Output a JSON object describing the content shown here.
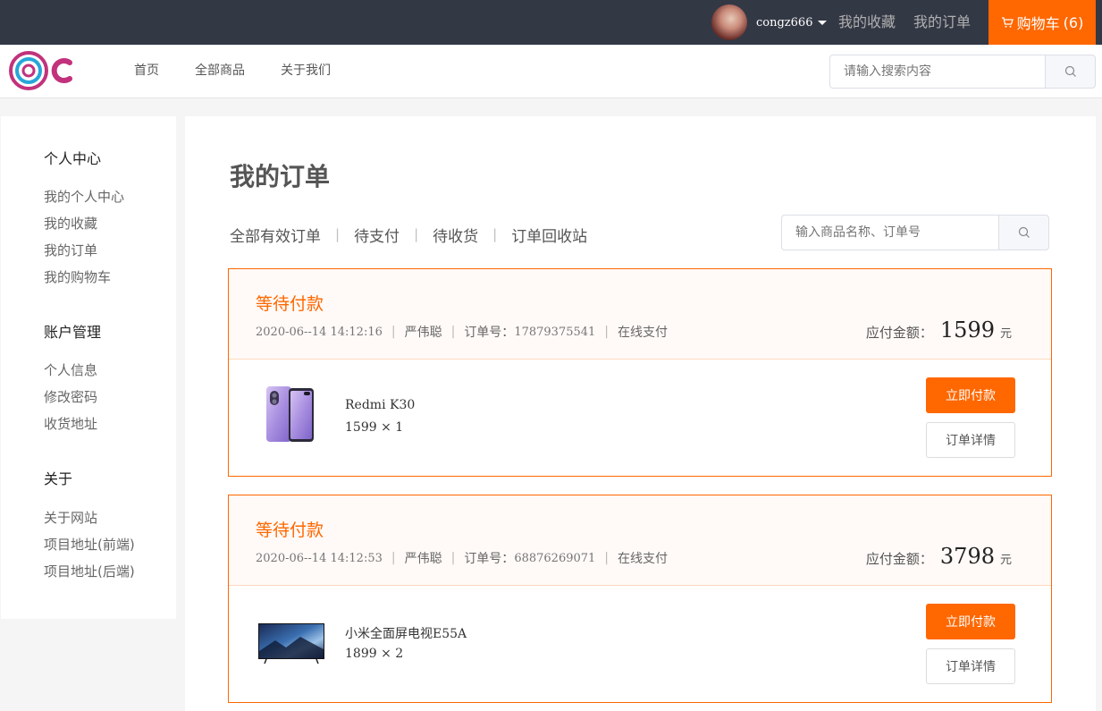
{
  "topbar": {
    "username": "congz666",
    "links": [
      "我的收藏",
      "我的订单"
    ],
    "cart_label": "购物车",
    "cart_count": "(6)"
  },
  "header": {
    "nav": [
      "首页",
      "全部商品",
      "关于我们"
    ],
    "search_placeholder": "请输入搜索内容"
  },
  "sidebar": {
    "groups": [
      {
        "title": "个人中心",
        "items": [
          "我的个人中心",
          "我的收藏",
          "我的订单",
          "我的购物车"
        ]
      },
      {
        "title": "账户管理",
        "items": [
          "个人信息",
          "修改密码",
          "收货地址"
        ]
      },
      {
        "title": "关于",
        "items": [
          "关于网站",
          "项目地址(前端)",
          "项目地址(后端)"
        ]
      }
    ]
  },
  "main": {
    "title": "我的订单",
    "filters": [
      "全部有效订单",
      "待支付",
      "待收货",
      "订单回收站"
    ],
    "search_placeholder": "输入商品名称、订单号"
  },
  "orders": [
    {
      "status": "等待付款",
      "time": "2020-06--14 14:12:16",
      "buyer": "严伟聪",
      "order_no_label": "订单号：",
      "order_no": "17879375541",
      "payment": "在线支付",
      "amount_label": "应付金额：",
      "amount": "1599",
      "currency": "元",
      "product_name": "Redmi K30",
      "product_qty": "1599 × 1",
      "pay_label": "立即付款",
      "detail_label": "订单详情",
      "thumb_icon": "phone-image-icon"
    },
    {
      "status": "等待付款",
      "time": "2020-06--14 14:12:53",
      "buyer": "严伟聪",
      "order_no_label": "订单号：",
      "order_no": "68876269071",
      "payment": "在线支付",
      "amount_label": "应付金额：",
      "amount": "3798",
      "currency": "元",
      "product_name": "小米全面屏电视E55A",
      "product_qty": "1899 × 2",
      "pay_label": "立即付款",
      "detail_label": "订单详情",
      "thumb_icon": "tv-image-icon"
    }
  ],
  "colors": {
    "accent": "#ff6700",
    "topbar": "#333845"
  }
}
